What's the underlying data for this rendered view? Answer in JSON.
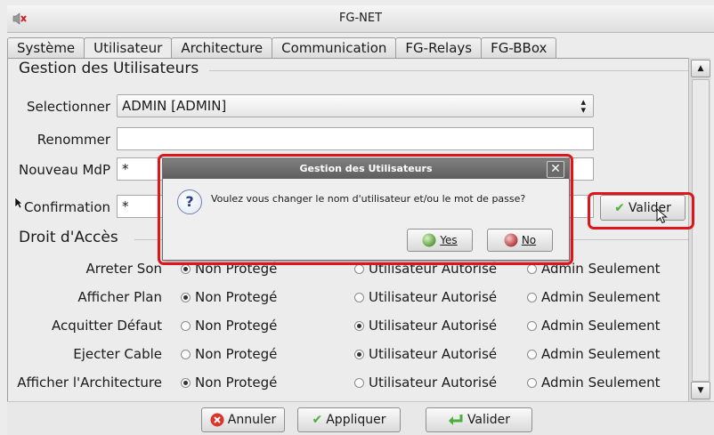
{
  "window": {
    "title": "FG-NET"
  },
  "tabs": [
    "Système",
    "Utilisateur",
    "Architecture",
    "Communication",
    "FG-Relays",
    "FG-BBox"
  ],
  "active_tab": "Utilisateur",
  "users_section": {
    "title": "Gestion des Utilisateurs",
    "select_label": "Selectionner",
    "select_value": "ADMIN [ADMIN]",
    "rename_label": "Renommer",
    "rename_value": "",
    "new_pwd_label": "Nouveau MdP",
    "new_pwd_value": "*",
    "confirm_label": "Confirmation",
    "confirm_value": "*",
    "validate_button": "Valider"
  },
  "access_section": {
    "title": "Droit d'Accès",
    "options": [
      "Non Protegé",
      "Utilisateur Autorisé",
      "Admin Seulement"
    ],
    "rows": [
      {
        "label": "Arreter Son",
        "selected": 0
      },
      {
        "label": "Afficher Plan",
        "selected": 0
      },
      {
        "label": "Acquitter Défaut",
        "selected": 1
      },
      {
        "label": "Ejecter Cable",
        "selected": 1
      },
      {
        "label": "Afficher l'Architecture",
        "selected": 0
      }
    ]
  },
  "bottom_buttons": {
    "cancel": "Annuler",
    "apply": "Appliquer",
    "validate": "Valider"
  },
  "dialog": {
    "title": "Gestion des Utilisateurs",
    "message": "Voulez vous changer le nom d'utilisateur et/ou le mot de passe?",
    "yes_label": "Yes",
    "no_label": "No"
  },
  "colors": {
    "highlight": "#e0141b",
    "dialog_title_bg": "#6a6a6a",
    "check_green": "#4caf3a",
    "cancel_red": "#d9352c"
  }
}
